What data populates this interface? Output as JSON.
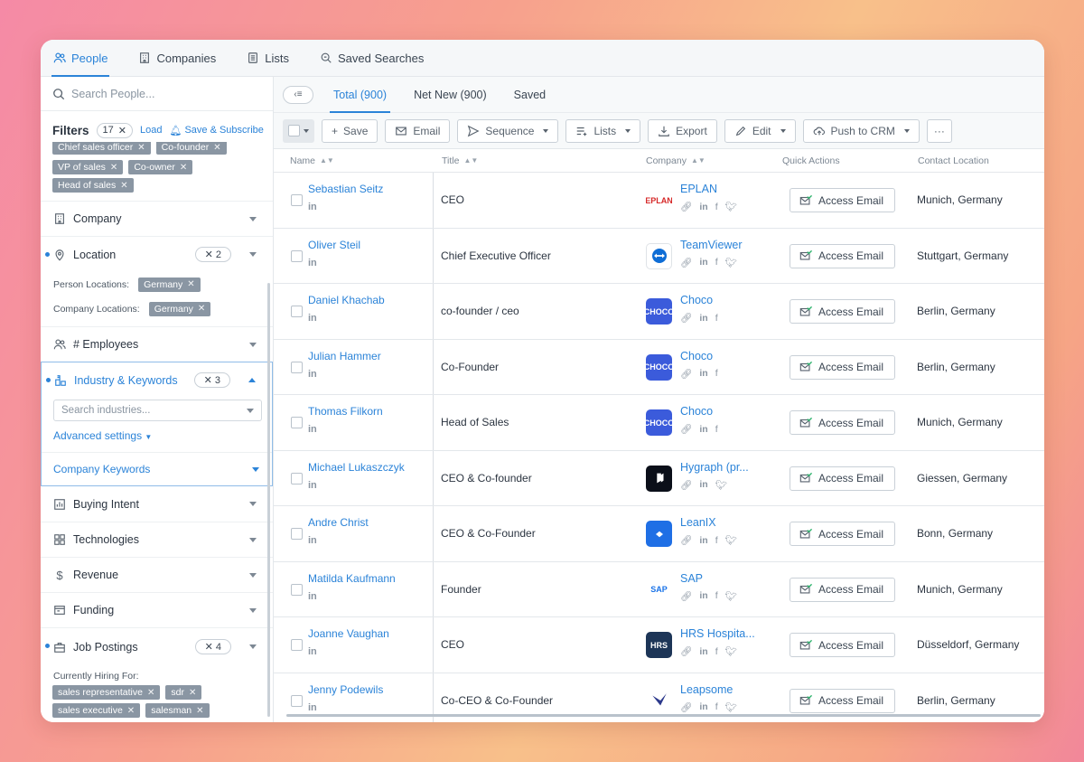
{
  "nav": {
    "tabs": [
      {
        "label": "People",
        "icon": "people-icon"
      },
      {
        "label": "Companies",
        "icon": "building-icon"
      },
      {
        "label": "Lists",
        "icon": "list-icon"
      },
      {
        "label": "Saved Searches",
        "icon": "saved-search-icon"
      }
    ],
    "accent": "#2b83d8"
  },
  "sidebar": {
    "search_placeholder": "Search People...",
    "filters_label": "Filters",
    "filters_count": "17",
    "load_label": "Load",
    "save_subscribe_label": "Save & Subscribe",
    "title_chips_top": [
      "Chief sales officer",
      "Co-founder"
    ],
    "title_chips": [
      "VP of sales",
      "Co-owner",
      "Head of sales"
    ],
    "company": {
      "label": "Company"
    },
    "location": {
      "label": "Location",
      "count": "2",
      "person_label": "Person Locations:",
      "person_value": "Germany",
      "company_label": "Company Locations:",
      "company_value": "Germany"
    },
    "employees": {
      "label": "# Employees"
    },
    "industry": {
      "label": "Industry & Keywords",
      "count": "3",
      "search_placeholder": "Search industries...",
      "advanced_label": "Advanced settings",
      "company_keywords_label": "Company Keywords"
    },
    "buying_intent": {
      "label": "Buying Intent"
    },
    "technologies": {
      "label": "Technologies"
    },
    "revenue": {
      "label": "Revenue"
    },
    "funding": {
      "label": "Funding"
    },
    "job_postings": {
      "label": "Job Postings",
      "count": "4",
      "hiring_label": "Currently Hiring For:",
      "chips": [
        "sales representative",
        "sdr",
        "sales executive",
        "salesman"
      ]
    }
  },
  "main": {
    "subtabs": [
      "Total (900)",
      "Net New (900)",
      "Saved"
    ],
    "toolbar": {
      "save": "Save",
      "email": "Email",
      "sequence": "Sequence",
      "lists": "Lists",
      "export": "Export",
      "edit": "Edit",
      "push": "Push to CRM",
      "more": "···"
    },
    "columns": {
      "name": "Name",
      "title": "Title",
      "company": "Company",
      "quick_actions": "Quick Actions",
      "contact_location": "Contact Location"
    },
    "access_email_label": "Access Email",
    "rows": [
      {
        "name": "Sebastian Seitz",
        "title": "CEO",
        "company": "EPLAN",
        "location": "Munich, Germany",
        "logo_color": "#ffffff",
        "logo_text": "EPLAN",
        "socials": [
          "link",
          "in",
          "f",
          "tw"
        ]
      },
      {
        "name": "Oliver Steil",
        "title": "Chief Executive Officer",
        "company": "TeamViewer",
        "location": "Stuttgart, Germany",
        "logo_color": "#ffffff",
        "logo_text": "",
        "socials": [
          "link",
          "in",
          "f",
          "tw"
        ]
      },
      {
        "name": "Daniel Khachab",
        "title": "co-founder / ceo",
        "company": "Choco",
        "location": "Berlin, Germany",
        "logo_color": "#3b5bdb",
        "logo_text": "CHOCO",
        "socials": [
          "link",
          "in",
          "f"
        ]
      },
      {
        "name": "Julian Hammer",
        "title": "Co-Founder",
        "company": "Choco",
        "location": "Berlin, Germany",
        "logo_color": "#3b5bdb",
        "logo_text": "CHOCO",
        "socials": [
          "link",
          "in",
          "f"
        ]
      },
      {
        "name": "Thomas Filkorn",
        "title": "Head of Sales",
        "company": "Choco",
        "location": "Munich, Germany",
        "logo_color": "#3b5bdb",
        "logo_text": "CHOCO",
        "socials": [
          "link",
          "in",
          "f"
        ]
      },
      {
        "name": "Michael Lukaszczyk",
        "title": "CEO & Co-founder",
        "company": "Hygraph (pr...",
        "location": "Giessen, Germany",
        "logo_color": "#0b0f19",
        "logo_text": "",
        "socials": [
          "link",
          "in",
          "tw"
        ]
      },
      {
        "name": "Andre Christ",
        "title": "CEO & Co-Founder",
        "company": "LeanIX",
        "location": "Bonn, Germany",
        "logo_color": "#1f6fe5",
        "logo_text": "",
        "socials": [
          "link",
          "in",
          "f",
          "tw"
        ]
      },
      {
        "name": "Matilda Kaufmann",
        "title": "Founder",
        "company": "SAP",
        "location": "Munich, Germany",
        "logo_color": "#ffffff",
        "logo_text": "SAP",
        "socials": [
          "link",
          "in",
          "f",
          "tw"
        ]
      },
      {
        "name": "Joanne Vaughan",
        "title": "CEO",
        "company": "HRS Hospita...",
        "location": "Düsseldorf, Germany",
        "logo_color": "#1d3557",
        "logo_text": "HRS",
        "socials": [
          "link",
          "in",
          "f",
          "tw"
        ]
      },
      {
        "name": "Jenny Podewils",
        "title": "Co-CEO & Co-Founder",
        "company": "Leapsome",
        "location": "Berlin, Germany",
        "logo_color": "#ffffff",
        "logo_text": "",
        "socials": [
          "link",
          "in",
          "f",
          "tw"
        ]
      }
    ]
  }
}
